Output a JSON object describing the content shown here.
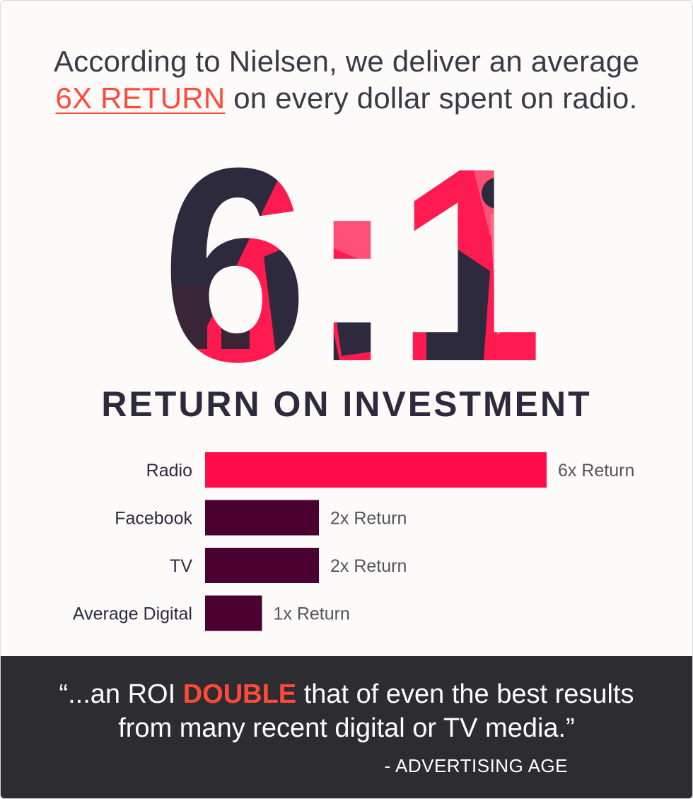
{
  "intro": {
    "line1": "According to Nielsen, we deliver an average",
    "highlight": "6X RETURN",
    "line2_rest": "on every dollar spent on radio."
  },
  "big_ratio": "6:1",
  "heading": "RETURN ON INVESTMENT",
  "colors": {
    "accent": "#ff0d4a",
    "highlight_text": "#ff4a3a",
    "dark_bar": "#4a0030",
    "navy": "#2d2a3e",
    "quote_band": "#2d2c31"
  },
  "chart_data": {
    "type": "bar",
    "orientation": "horizontal",
    "categories": [
      "Radio",
      "Facebook",
      "TV",
      "Average Digital"
    ],
    "values": [
      6,
      2,
      2,
      1
    ],
    "labels": [
      "6x Return",
      "2x Return",
      "2x Return",
      "1x Return"
    ],
    "title": "RETURN ON INVESTMENT",
    "xlim": [
      0,
      6
    ],
    "grid": false
  },
  "quote": {
    "open": "“...an ROI ",
    "highlight": "DOUBLE",
    "rest1": " that of even the best results",
    "line2": "from many recent digital or TV media.”",
    "attribution": "- ADVERTISING AGE"
  }
}
